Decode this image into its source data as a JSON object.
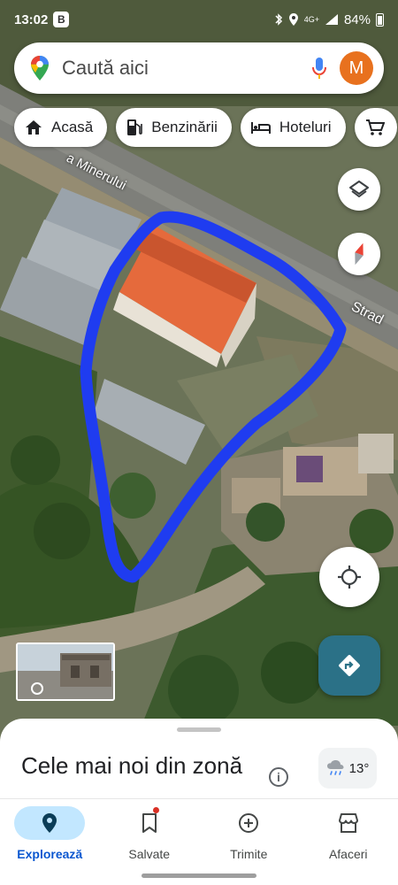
{
  "status_bar": {
    "time": "13:02",
    "badge": "B",
    "network": "4G+",
    "battery": "84%"
  },
  "search": {
    "placeholder": "Caută aici",
    "avatar_initial": "M"
  },
  "chips": [
    {
      "label": "Acasă",
      "icon": "home-icon"
    },
    {
      "label": "Benzinării",
      "icon": "gas-station-icon"
    },
    {
      "label": "Hoteluri",
      "icon": "bed-icon"
    },
    {
      "label": "",
      "icon": "cart-icon"
    }
  ],
  "map": {
    "street_labels": [
      "a Minerului",
      "Strad"
    ],
    "drawn_outline_color": "#1f3cf0",
    "roof_color": "#e56a3c"
  },
  "bottom_sheet": {
    "title": "Cele mai noi din zonă",
    "weather_temp": "13°"
  },
  "bottom_nav": [
    {
      "label": "Explorează",
      "icon": "explore-pin-icon",
      "active": true
    },
    {
      "label": "Salvate",
      "icon": "bookmark-icon",
      "active": false
    },
    {
      "label": "Trimite",
      "icon": "add-circle-icon",
      "active": false
    },
    {
      "label": "Afaceri",
      "icon": "storefront-icon",
      "active": false
    }
  ],
  "colors": {
    "accent": "#0b57d0",
    "active_pill": "#c2e7ff",
    "directions": "#2b7187",
    "avatar": "#e8711e"
  }
}
